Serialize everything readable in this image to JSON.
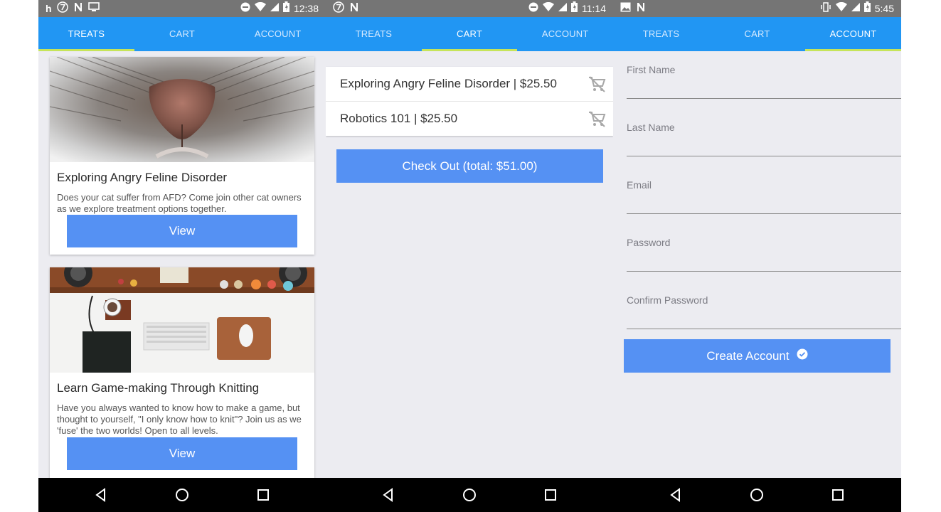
{
  "screens": [
    {
      "status": {
        "left_icons": [
          "h-app-icon",
          "seven-icon",
          "n-icon",
          "screen-icon"
        ],
        "time": "12:38"
      },
      "tabs": [
        {
          "label": "TREATS"
        },
        {
          "label": "CART"
        },
        {
          "label": "ACCOUNT"
        }
      ],
      "active_tab": "TREATS",
      "cards": [
        {
          "image": "cat-nose-photo",
          "title": "Exploring Angry Feline Disorder",
          "description": "Does your cat suffer from AFD? Come join other cat owners as we explore treatment options together.",
          "button": "View"
        },
        {
          "image": "desk-flatlay-photo",
          "title": "Learn Game-making Through Knitting",
          "description": "Have you always wanted to know how to make a game, but thought to yourself, \"I only know how to knit\"? Join us as we 'fuse' the two worlds! Open to all levels.",
          "button": "View"
        }
      ]
    },
    {
      "status": {
        "left_icons": [
          "seven-icon",
          "n-icon"
        ],
        "time": "11:14"
      },
      "tabs": [
        {
          "label": "TREATS"
        },
        {
          "label": "CART"
        },
        {
          "label": "ACCOUNT"
        }
      ],
      "active_tab": "CART",
      "cart_items": [
        {
          "text": "Exploring Angry Feline Disorder | $25.50",
          "icon": "remove-from-cart-icon"
        },
        {
          "text": "Robotics 101 | $25.50",
          "icon": "remove-from-cart-icon"
        }
      ],
      "checkout_button": "Check Out (total: $51.00)"
    },
    {
      "status": {
        "left_icons": [
          "image-icon",
          "n-icon"
        ],
        "time": "5:45"
      },
      "tabs": [
        {
          "label": "TREATS"
        },
        {
          "label": "CART"
        },
        {
          "label": "ACCOUNT"
        }
      ],
      "active_tab": "ACCOUNT",
      "fields": [
        {
          "label": "First Name",
          "value": ""
        },
        {
          "label": "Last Name",
          "value": ""
        },
        {
          "label": "Email",
          "value": ""
        },
        {
          "label": "Password",
          "value": ""
        },
        {
          "label": "Confirm Password",
          "value": ""
        }
      ],
      "create_button": "Create Account",
      "create_icon": "check-circle-icon"
    }
  ],
  "colors": {
    "status_bar": "#757575",
    "tab_bar": "#2196f3",
    "tab_indicator": "#c6e45a",
    "button": "#5591f3",
    "background": "#ececf1",
    "nav_bar": "#000000"
  }
}
